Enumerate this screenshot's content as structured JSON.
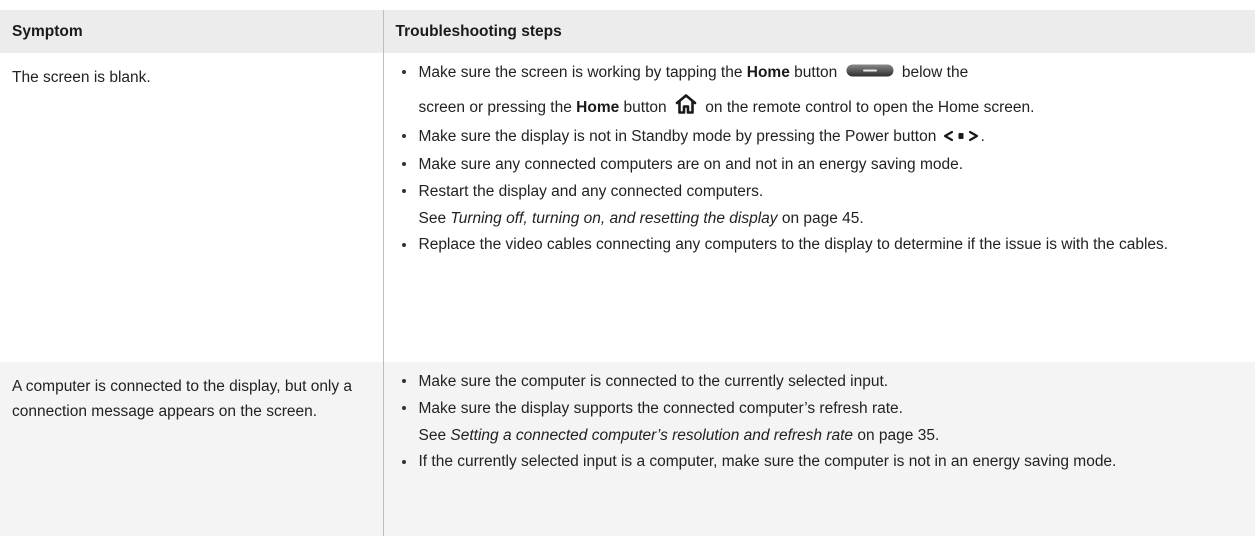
{
  "table": {
    "headers": [
      "Symptom",
      "Troubleshooting steps"
    ],
    "rows": [
      {
        "symptom": "The screen is blank.",
        "home_step": {
          "p1": "Make sure the screen is working by tapping the ",
          "home_label": "Home",
          "p2": " button ",
          "p3": " below the",
          "p4": "screen or pressing the ",
          "home_label_2": "Home",
          "p5": " button ",
          "p6": " on the remote control to open the Home screen."
        },
        "standby_step": {
          "text": "Make sure the display is not in Standby mode by pressing the Power button ",
          "end": "."
        },
        "computers_on": "Make sure any connected computers are on and not in an energy saving mode.",
        "restart": "Restart the display and any connected computers.",
        "see_ref": {
          "prefix": "See ",
          "title": "Turning off, turning on, and resetting the display",
          "suffix": " on page 45."
        },
        "replace_cables": "Replace the video cables connecting any computers to the display to determine if the issue is with the cables."
      },
      {
        "symptom": "A computer is connected to the display, but only a connection message appears on the screen.",
        "selected_input": "Make sure the computer is connected to the currently selected input.",
        "refresh_rate": "Make sure the display supports the connected computer’s refresh rate.",
        "see_ref": {
          "prefix": "See ",
          "title": "Setting a connected computer’s resolution and refresh rate",
          "suffix": " on page 35."
        },
        "energy_mode": "If the currently selected input is a computer, make sure the computer is not in an energy saving mode."
      }
    ]
  },
  "icons": {
    "home_button": "home-button-icon",
    "home_remote": "home-house-icon",
    "power_button": "power-button-icon"
  },
  "colors": {
    "header_bg": "#ececec",
    "row_alt_bg": "#f4f4f4",
    "divider": "#bdbdbd"
  }
}
